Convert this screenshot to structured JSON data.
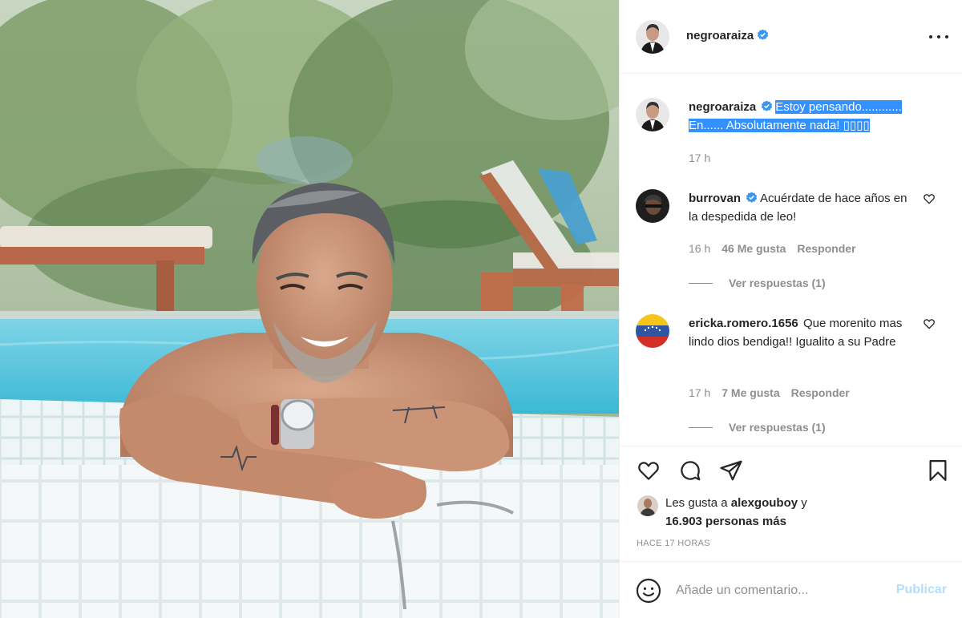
{
  "post": {
    "author": "negroaraiza",
    "caption_line1": "Estoy pensando............",
    "caption_line2": "En...... Absolutamente nada! ▯▯▯▯",
    "caption_time": "17 h"
  },
  "comments": [
    {
      "username": "burrovan",
      "verified": true,
      "text": "Acuérdate de hace años en la despedida de leo!",
      "time": "16 h",
      "likes": "46 Me gusta",
      "reply_label": "Responder",
      "view_replies": "Ver respuestas (1)"
    },
    {
      "username": "ericka.romero.1656",
      "verified": false,
      "text": "Que morenito mas lindo dios bendiga!! Igualito a su Padre",
      "time": "17 h",
      "likes": "7 Me gusta",
      "reply_label": "Responder",
      "view_replies": "Ver respuestas (1)"
    }
  ],
  "likes": {
    "prefix": "Les gusta a ",
    "user": "alexgouboy",
    "suffix": " y",
    "others": "16.903 personas más"
  },
  "timestamp": "HACE 17 HORAS",
  "add_comment": {
    "placeholder": "Añade un comentario...",
    "publish_label": "Publicar"
  },
  "icons": {
    "options": "more-options-icon",
    "like": "heart-icon",
    "comment": "comment-icon",
    "share": "share-icon",
    "save": "bookmark-icon",
    "emoji": "emoji-icon"
  },
  "colors": {
    "verified_blue": "#3897f0",
    "selection": "#3390ff",
    "publish_disabled": "#b2dffc",
    "secondary_text": "#8e8e8e"
  }
}
